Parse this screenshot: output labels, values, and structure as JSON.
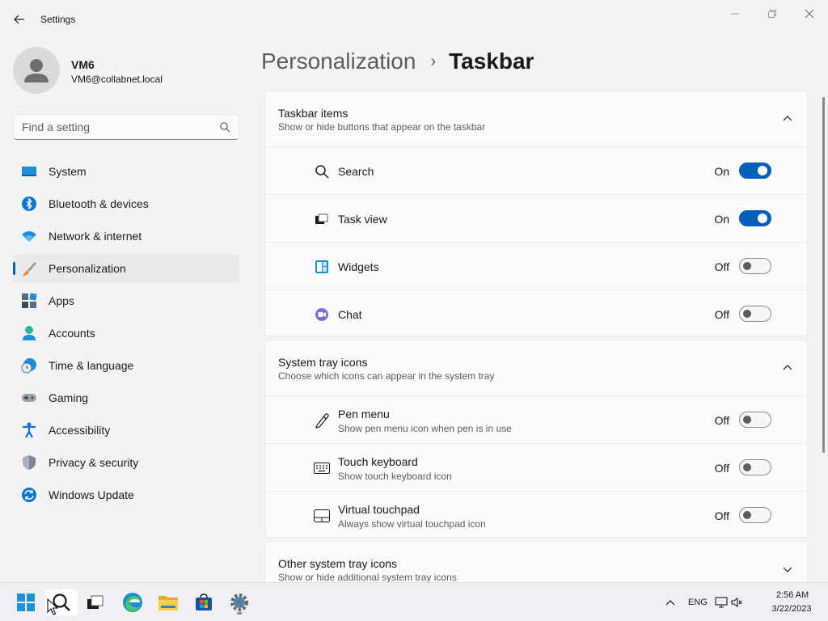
{
  "window": {
    "title": "Settings"
  },
  "profile": {
    "name": "VM6",
    "email": "VM6@collabnet.local"
  },
  "search": {
    "placeholder": "Find a setting"
  },
  "nav": {
    "items": [
      {
        "label": "System",
        "icon": "system-icon"
      },
      {
        "label": "Bluetooth & devices",
        "icon": "bluetooth-icon"
      },
      {
        "label": "Network & internet",
        "icon": "wifi-icon"
      },
      {
        "label": "Personalization",
        "icon": "paintbrush-icon",
        "selected": true
      },
      {
        "label": "Apps",
        "icon": "apps-icon"
      },
      {
        "label": "Accounts",
        "icon": "accounts-icon"
      },
      {
        "label": "Time & language",
        "icon": "clock-globe-icon"
      },
      {
        "label": "Gaming",
        "icon": "gamepad-icon"
      },
      {
        "label": "Accessibility",
        "icon": "accessibility-icon"
      },
      {
        "label": "Privacy & security",
        "icon": "shield-icon"
      },
      {
        "label": "Windows Update",
        "icon": "update-icon"
      }
    ]
  },
  "breadcrumb": {
    "parent": "Personalization",
    "separator": "›",
    "current": "Taskbar"
  },
  "taskbar_items": {
    "title": "Taskbar items",
    "description": "Show or hide buttons that appear on the taskbar",
    "rows": [
      {
        "label": "Search",
        "state": "On",
        "icon": "search-icon"
      },
      {
        "label": "Task view",
        "state": "On",
        "icon": "task-view-icon"
      },
      {
        "label": "Widgets",
        "state": "Off",
        "icon": "widgets-icon"
      },
      {
        "label": "Chat",
        "state": "Off",
        "icon": "chat-icon"
      }
    ]
  },
  "system_tray": {
    "title": "System tray icons",
    "description": "Choose which icons can appear in the system tray",
    "rows": [
      {
        "label": "Pen menu",
        "sub": "Show pen menu icon when pen is in use",
        "state": "Off",
        "icon": "pen-icon"
      },
      {
        "label": "Touch keyboard",
        "sub": "Show touch keyboard icon",
        "state": "Off",
        "icon": "keyboard-icon"
      },
      {
        "label": "Virtual touchpad",
        "sub": "Always show virtual touchpad icon",
        "state": "Off",
        "icon": "touchpad-icon"
      }
    ]
  },
  "other_tray": {
    "title": "Other system tray icons",
    "description": "Show or hide additional system tray icons"
  },
  "taskbar": {
    "apps": [
      "start-icon",
      "search-icon",
      "task-view-icon",
      "edge-icon",
      "file-explorer-icon",
      "store-icon",
      "settings-icon"
    ],
    "language": "ENG",
    "time": "2:56 AM",
    "date": "3/22/2023"
  },
  "colors": {
    "accent": "#005fb8",
    "background": "#f3f3f3",
    "card": "#fbfbfb"
  }
}
